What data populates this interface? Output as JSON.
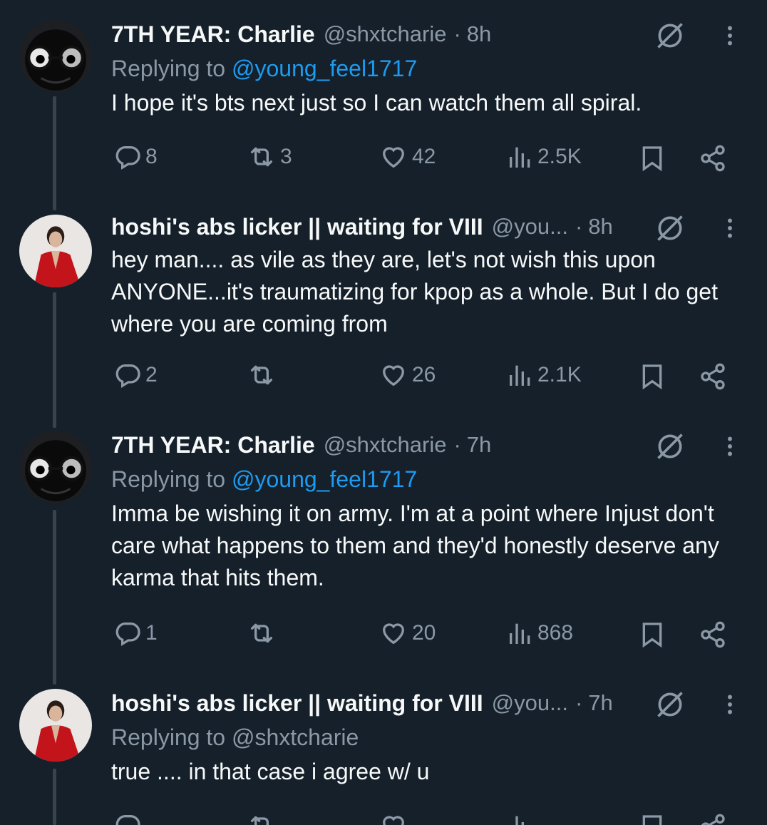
{
  "colors": {
    "background": "#15202b",
    "muted": "#8b98a5",
    "link": "#1d9bf0",
    "text": "#f7f9f9"
  },
  "tweets": [
    {
      "display_name": "7TH YEAR: Charlie",
      "handle": "@shxtcharie",
      "dot": "·",
      "time": "8h",
      "avatar": "dark-cartoon-glasses-avatar",
      "reply_prefix": "Replying to ",
      "reply_to": "@young_feel1717",
      "text": "I hope it's bts next just so I can watch them all spiral.",
      "stats": {
        "replies": "8",
        "reposts": "3",
        "likes": "42",
        "views": "2.5K"
      }
    },
    {
      "display_name": "hoshi's abs licker || waiting for VIII",
      "handle": "@you...",
      "dot": "·",
      "time": "8h",
      "avatar": "person-red-jacket-avatar",
      "text": "hey man.... as vile as they are, let's not wish this upon ANYONE...it's traumatizing for kpop as a whole. But I do get where you are coming from",
      "stats": {
        "replies": "2",
        "reposts": "",
        "likes": "26",
        "views": "2.1K"
      }
    },
    {
      "display_name": "7TH YEAR: Charlie",
      "handle": "@shxtcharie",
      "dot": "·",
      "time": "7h",
      "avatar": "dark-cartoon-glasses-avatar",
      "reply_prefix": "Replying to ",
      "reply_to": "@young_feel1717",
      "text": "Imma be wishing it on army. I'm at a point where Injust don't care what happens to them and they'd honestly deserve any karma that hits them.",
      "stats": {
        "replies": "1",
        "reposts": "",
        "likes": "20",
        "views": "868"
      }
    },
    {
      "display_name": "hoshi's abs licker || waiting for VIII",
      "handle": "@you...",
      "dot": "·",
      "time": "7h",
      "avatar": "person-red-jacket-avatar",
      "reply_prefix": "Replying to ",
      "reply_to": "@shxtcharie",
      "text": "true .... in that case i agree w/ u"
    }
  ]
}
